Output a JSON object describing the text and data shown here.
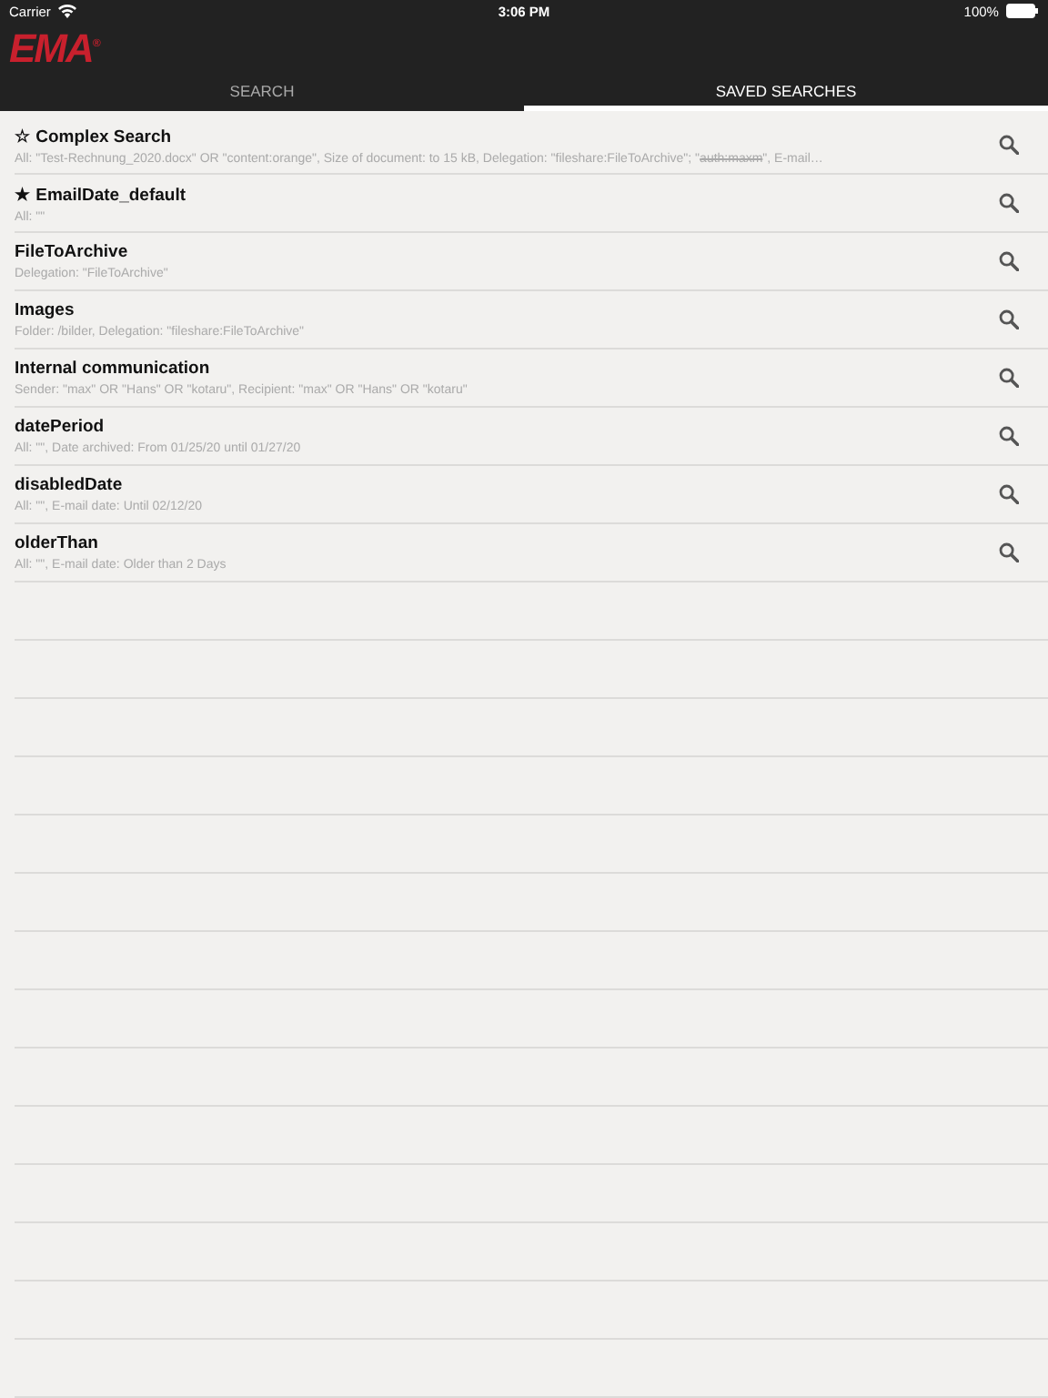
{
  "status_bar": {
    "carrier": "Carrier",
    "time": "3:06 PM",
    "battery": "100%"
  },
  "logo": "EMA$^{®}$",
  "tabs": [
    {
      "label": "SEARCH",
      "selected": false
    },
    {
      "label": "SAVED SEARCHES",
      "selected": true
    }
  ],
  "saved_searches": [
    {
      "title": "☆ Complex Search",
      "description": [
        {
          "text": "All: \"Test-Rechnung_2020.docx\" OR \"content:orange\", Size of document: to 15 kB, Delegation: \"fileshare:FileToArchive\"; \"",
          "struck": false
        },
        {
          "text": "auth:maxm",
          "struck": true
        },
        {
          "text": "\", E-mail…",
          "struck": false
        }
      ]
    },
    {
      "title": "★ EmailDate_default",
      "description": [
        {
          "text": "All: \"\"",
          "struck": false
        }
      ]
    },
    {
      "title": "FileToArchive",
      "description": [
        {
          "text": "Delegation: \"FileToArchive\"",
          "struck": false
        }
      ]
    },
    {
      "title": "Images",
      "description": [
        {
          "text": "Folder: /bilder, Delegation: \"fileshare:FileToArchive\"",
          "struck": false
        }
      ]
    },
    {
      "title": "Internal communication",
      "description": [
        {
          "text": "Sender: \"max\" OR \"Hans\" OR \"kotaru\", Recipient: \"max\" OR \"Hans\" OR \"kotaru\"",
          "struck": false
        }
      ]
    },
    {
      "title": "datePeriod",
      "description": [
        {
          "text": "All: \"\", Date archived:  From 01/25/20 until 01/27/20",
          "struck": false
        }
      ]
    },
    {
      "title": "disabledDate",
      "description": [
        {
          "text": "All: \"\", E-mail date:  Until 02/12/20",
          "struck": false
        }
      ]
    },
    {
      "title": "olderThan",
      "description": [
        {
          "text": "All: \"\", E-mail date: Older than 2 Days",
          "struck": false
        }
      ]
    }
  ]
}
